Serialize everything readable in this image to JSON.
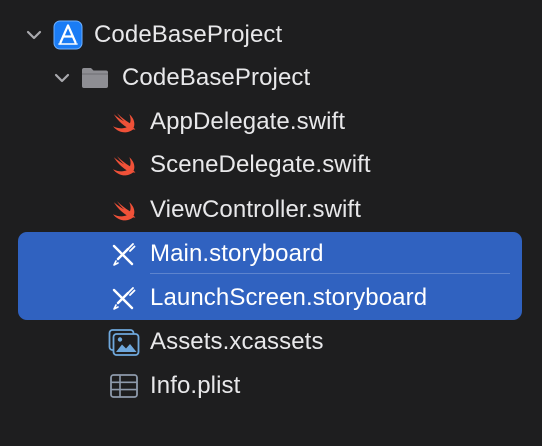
{
  "theme": {
    "background": "#1e1e1f",
    "selection": "#3062c0",
    "text": "#e8e8ea",
    "swift_orange": "#f05138",
    "project_blue": "#1a7cf5",
    "folder_gray": "#8e8e93"
  },
  "tree": {
    "project": {
      "label": "CodeBaseProject",
      "icon": "xcode-project-icon",
      "expanded": true
    },
    "group": {
      "label": "CodeBaseProject",
      "icon": "folder-icon",
      "expanded": true
    },
    "files": [
      {
        "label": "AppDelegate.swift",
        "icon": "swift-icon",
        "selected": false
      },
      {
        "label": "SceneDelegate.swift",
        "icon": "swift-icon",
        "selected": false
      },
      {
        "label": "ViewController.swift",
        "icon": "swift-icon",
        "selected": false
      },
      {
        "label": "Main.storyboard",
        "icon": "storyboard-icon",
        "selected": true
      },
      {
        "label": "LaunchScreen.storyboard",
        "icon": "storyboard-icon",
        "selected": true
      },
      {
        "label": "Assets.xcassets",
        "icon": "asset-catalog-icon",
        "selected": false
      },
      {
        "label": "Info.plist",
        "icon": "plist-icon",
        "selected": false
      }
    ]
  }
}
